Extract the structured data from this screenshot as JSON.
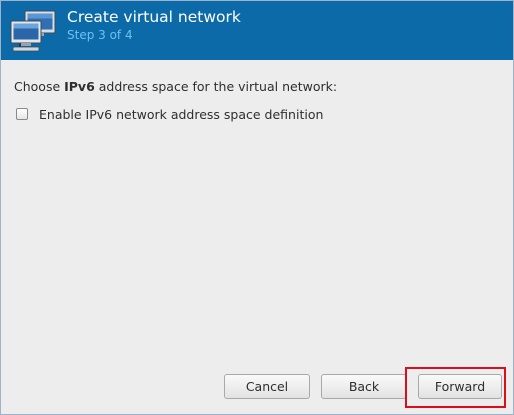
{
  "window": {
    "title": "Create virtual network",
    "step": "Step 3 of 4",
    "icon": "network-computers-icon"
  },
  "content": {
    "prompt_before": "Choose ",
    "prompt_bold": "IPv6",
    "prompt_after": " address space for the virtual network:",
    "enable_ipv6": {
      "label": "Enable IPv6 network address space definition",
      "checked": false
    }
  },
  "buttons": {
    "cancel": "Cancel",
    "back": "Back",
    "forward": "Forward"
  },
  "colors": {
    "banner": "#0b6aa7",
    "subtitle": "#6fc0f2",
    "highlight": "#d9101b"
  }
}
